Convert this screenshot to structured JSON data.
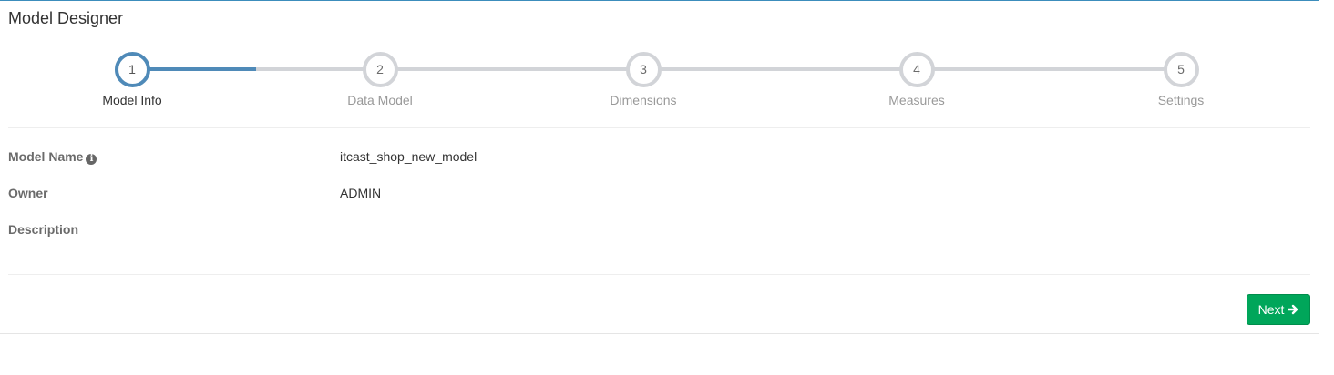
{
  "header": {
    "title": "Model Designer"
  },
  "wizard": {
    "progress": 0.118,
    "steps": [
      {
        "number": "1",
        "label": "Model Info",
        "active": true
      },
      {
        "number": "2",
        "label": "Data Model",
        "active": false
      },
      {
        "number": "3",
        "label": "Dimensions",
        "active": false
      },
      {
        "number": "4",
        "label": "Measures",
        "active": false
      },
      {
        "number": "5",
        "label": "Settings",
        "active": false
      }
    ]
  },
  "form": {
    "model_name": {
      "label": "Model Name",
      "value": "itcast_shop_new_model",
      "icon": "info-icon"
    },
    "owner": {
      "label": "Owner",
      "value": "ADMIN"
    },
    "description": {
      "label": "Description",
      "value": ""
    }
  },
  "actions": {
    "next_label": "Next",
    "next_icon": "arrow-right-icon"
  },
  "colors": {
    "accent": "#4f8ab8",
    "inactive": "#d2d4d8",
    "success": "#00a65a"
  }
}
